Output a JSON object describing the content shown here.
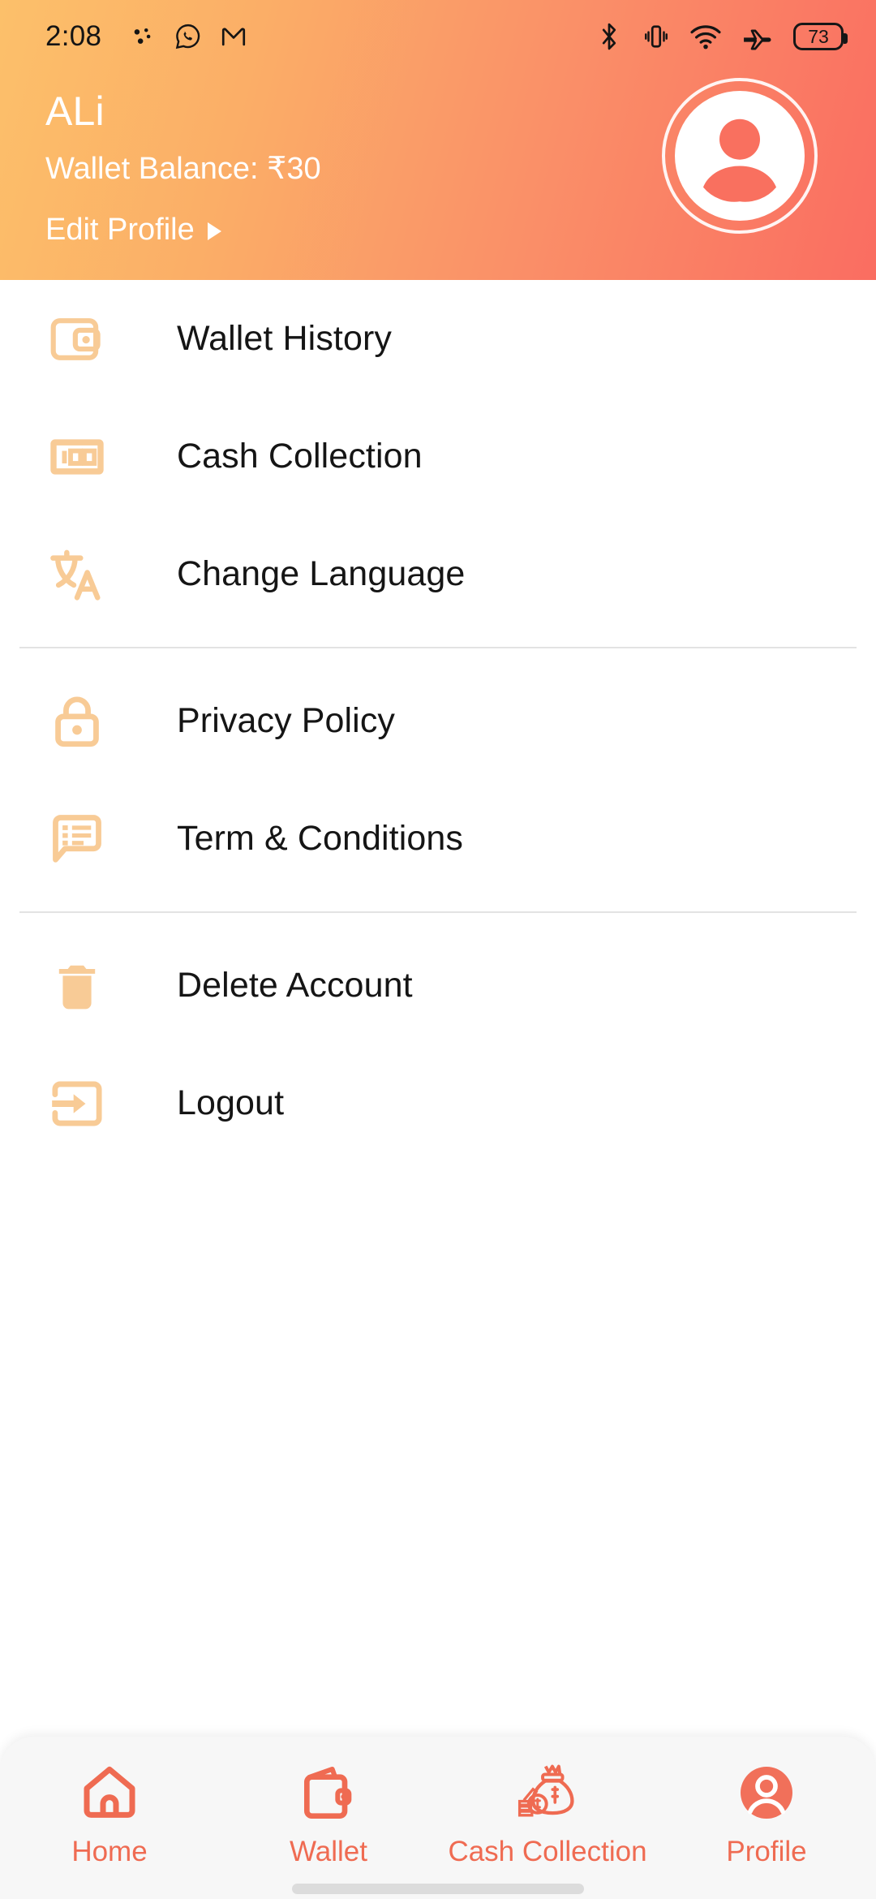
{
  "status_bar": {
    "time": "2:08",
    "left_icons": [
      "dots-notification-icon",
      "whatsapp-icon",
      "gmail-icon"
    ],
    "right_icons": [
      "bluetooth-icon",
      "vibrate-icon",
      "wifi-icon",
      "airplane-mode-icon"
    ],
    "battery_level": "73"
  },
  "header": {
    "user_name": "ALi",
    "wallet_balance": "Wallet Balance: ₹30",
    "edit_profile_label": "Edit Profile",
    "avatar_icon": "person-avatar-icon",
    "gradient_start": "#fcc06a",
    "gradient_end": "#fa6d61"
  },
  "menu": {
    "icon_color": "#f8cb96",
    "groups": [
      {
        "items": [
          {
            "label": "Wallet History",
            "icon": "wallet-icon"
          },
          {
            "label": "Cash Collection",
            "icon": "banknote-100-icon"
          },
          {
            "label": "Change Language",
            "icon": "translate-icon"
          }
        ]
      },
      {
        "items": [
          {
            "label": "Privacy Policy",
            "icon": "lock-icon"
          },
          {
            "label": "Term & Conditions",
            "icon": "chat-list-icon"
          }
        ]
      },
      {
        "items": [
          {
            "label": "Delete Account",
            "icon": "trash-icon"
          },
          {
            "label": "Logout",
            "icon": "logout-arrow-icon"
          }
        ]
      }
    ]
  },
  "bottom_nav": {
    "accent_color": "#ef6b52",
    "active_index": 3,
    "items": [
      {
        "label": "Home",
        "icon": "home-icon"
      },
      {
        "label": "Wallet",
        "icon": "wallet-icon"
      },
      {
        "label": "Cash Collection",
        "icon": "money-bag-icon"
      },
      {
        "label": "Profile",
        "icon": "profile-person-icon"
      }
    ]
  }
}
